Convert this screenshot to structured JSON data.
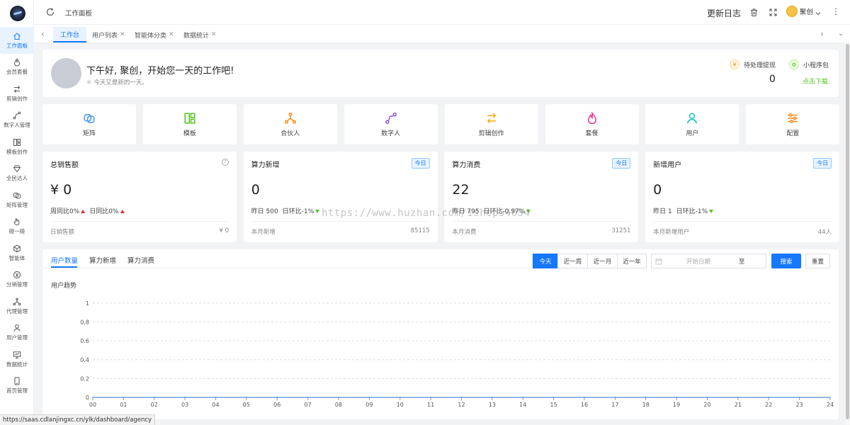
{
  "app": {
    "title": "工作面板",
    "update_log": "更新日志",
    "user_name": "聚创"
  },
  "sidebar": {
    "items": [
      {
        "label": "工作面板",
        "icon": "home-icon"
      },
      {
        "label": "会员套餐",
        "icon": "fire-icon"
      },
      {
        "label": "剪辑创作",
        "icon": "switch-icon"
      },
      {
        "label": "数字人管理",
        "icon": "curve-icon"
      },
      {
        "label": "模板创作",
        "icon": "template-icon"
      },
      {
        "label": "全民达人",
        "icon": "diamond-icon"
      },
      {
        "label": "矩阵管理",
        "icon": "matrix-icon"
      },
      {
        "label": "碰一碰",
        "icon": "hand-icon"
      },
      {
        "label": "智能体",
        "icon": "cube-icon"
      },
      {
        "label": "分销管理",
        "icon": "yen-icon"
      },
      {
        "label": "代理管理",
        "icon": "network-icon"
      },
      {
        "label": "用户管理",
        "icon": "user-icon"
      },
      {
        "label": "数据统计",
        "icon": "monitor-icon"
      },
      {
        "label": "首页管理",
        "icon": "phone-icon"
      }
    ]
  },
  "tabs": [
    {
      "label": "工作台",
      "closable": false,
      "active": true
    },
    {
      "label": "用户列表",
      "closable": true,
      "active": false
    },
    {
      "label": "智能体分类",
      "closable": true,
      "active": false
    },
    {
      "label": "数据统计",
      "closable": true,
      "active": false
    }
  ],
  "welcome": {
    "greeting": "下午好, 聚创，开始您一天的工作吧!",
    "subtitle": "今天又是新的一天。",
    "pending_label": "待处理提现",
    "pending_value": "0",
    "miniapp_label": "小程序包",
    "miniapp_link": "点击下载"
  },
  "quick_links": [
    {
      "label": "矩阵",
      "icon": "matrix-icon",
      "color": "#4096ff"
    },
    {
      "label": "模板",
      "icon": "template-icon",
      "color": "#52c41a"
    },
    {
      "label": "合伙人",
      "icon": "network-icon",
      "color": "#fa8c16"
    },
    {
      "label": "数字人",
      "icon": "curve-icon",
      "color": "#9254de"
    },
    {
      "label": "剪辑创作",
      "icon": "switch-icon",
      "color": "#faad14"
    },
    {
      "label": "套餐",
      "icon": "fire-icon",
      "color": "#eb2f96"
    },
    {
      "label": "用户",
      "icon": "user-icon",
      "color": "#13c2c2"
    },
    {
      "label": "配置",
      "icon": "sliders-icon",
      "color": "#fa8c16"
    }
  ],
  "stats": [
    {
      "title": "总销售额",
      "badge": "",
      "value": "¥ 0",
      "compare": [
        {
          "text": "周同比0%",
          "trend": "up"
        },
        {
          "text": "日同比0%",
          "trend": "up"
        }
      ],
      "foot_label": "日销售额",
      "foot_value": "¥ 0"
    },
    {
      "title": "算力新增",
      "badge": "今日",
      "value": "0",
      "compare": [
        {
          "text": "昨日 500",
          "trend": ""
        },
        {
          "text": "日环比-1%",
          "trend": "down"
        }
      ],
      "foot_label": "本月新增",
      "foot_value": "85115"
    },
    {
      "title": "算力消费",
      "badge": "今日",
      "value": "22",
      "compare": [
        {
          "text": "昨日 795",
          "trend": ""
        },
        {
          "text": "日环比-0.97%",
          "trend": "down"
        }
      ],
      "foot_label": "本月消费",
      "foot_value": "31251"
    },
    {
      "title": "新增用户",
      "badge": "今日",
      "value": "0",
      "compare": [
        {
          "text": "昨日 1",
          "trend": ""
        },
        {
          "text": "日环比-1%",
          "trend": "down"
        }
      ],
      "foot_label": "本月新增用户",
      "foot_value": "44人"
    }
  ],
  "chart_panel": {
    "tabs": [
      "用户数量",
      "算力新增",
      "算力消费"
    ],
    "ranges": [
      "今天",
      "近一周",
      "近一月",
      "近一年"
    ],
    "date_placeholder": "开始日期",
    "date_sep": "至",
    "search": "搜索",
    "reset": "重置"
  },
  "chart_data": {
    "type": "line",
    "title": "用户趋势",
    "categories": [
      "00",
      "01",
      "02",
      "03",
      "04",
      "05",
      "06",
      "07",
      "08",
      "09",
      "10",
      "11",
      "12",
      "13",
      "14",
      "15",
      "16",
      "17",
      "18",
      "19",
      "20",
      "21",
      "22",
      "23",
      "24"
    ],
    "series": [
      {
        "values": [
          0,
          0,
          0,
          0,
          0,
          0,
          0,
          0,
          0,
          0,
          0,
          0,
          0,
          0,
          0,
          0,
          0,
          0,
          0,
          0,
          0,
          0,
          0,
          0,
          0
        ]
      }
    ],
    "ylim": [
      0,
      1
    ],
    "yticks": [
      "0",
      "0.2",
      "0.4",
      "0.6",
      "0.8",
      "1"
    ],
    "grid": true
  },
  "watermark": "https://www.huzhan.com/ishop54054",
  "status_url": "https://saas.cdlanjingxc.cn/ylk/dashboard/agency",
  "colors": {
    "accent": "#1677ff",
    "up": "#f5222d",
    "down": "#52c41a"
  }
}
